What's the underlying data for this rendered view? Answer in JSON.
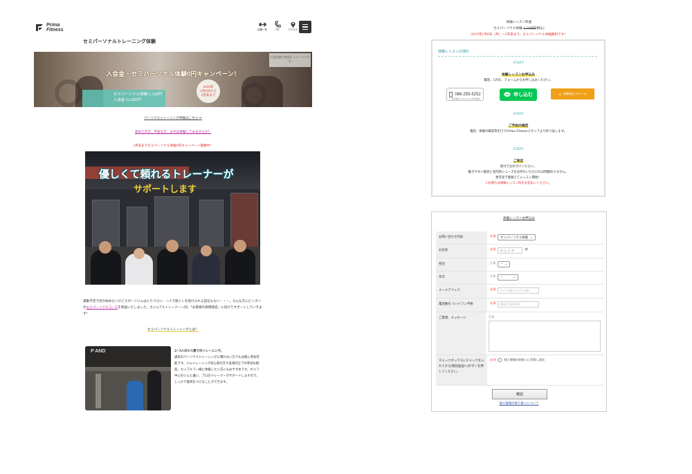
{
  "header": {
    "logo_line1": "Prima",
    "logo_line2": "Fitness",
    "icons": [
      {
        "name": "dumbbell-icon",
        "label": "店舗一覧"
      },
      {
        "name": "phone-icon",
        "label": "TEL"
      },
      {
        "name": "map-pin-icon",
        "label": "アクセス"
      }
    ],
    "menu_icon": "hamburger-menu-icon"
  },
  "page_title": "セミパーソナルトレーニング体験",
  "banner": {
    "headline": "入会金・セミパーソナル体験0円キャンペーン！",
    "price_line1": "セミパーソナル体験 1,100円",
    "price_line2": "入会金 11,000円",
    "circle_year": "2025年",
    "circle_from": "1月6日から",
    "circle_to": "2月末まで",
    "corner_text": "大型店舗で快適な トレーニングを"
  },
  "links": {
    "personal_experience": "パーソナルトレーニング体験はこちら",
    "beginner": "初めての方、不安な方、まずは体験してみませんか？",
    "campaign_red": "2月末までセミパーソナル体験0円キャンペーン開催中！"
  },
  "photo1": {
    "heading": "優しくて頼れるトレーナーが",
    "sub": "サポートします"
  },
  "intro_paragraph": {
    "before": "運動不足で何か始めたいけどスポーツジムは入りづらい、一人で筋トレを続けられる自信もない・・・。そんな方にピッタリの",
    "link": "セミパーソナルコース",
    "after": "を新設いたしました。カジュアルトレーナー一同、「お客様の目標達成」に向けてサポートしていきます！"
  },
  "what_is_link": "セミパーソナルトレーニングとは？",
  "side": {
    "bold": "2~3人の少人数でのトレーニング。",
    "body": "通常のパーソナルトレーニングに慣れない方でも気軽に参加可能です。ジムトレーニング初心者の方や友達同士での参加も歓迎。カップルで一緒に体験したい方にもおすすめです。セルフ中心のジムと違い、プロのトレーナーがサポートしますので、しっかり筋肉をつけることができます。"
  },
  "right_top": {
    "line1": "体験レッスン料金",
    "line2_prefix": "セミパーソナル体験",
    "line2_strike": "1,100円",
    "line2_suffix": "(税込)",
    "line3": "2025年1月6日（月）～2月末まで、セミパーソナル体験無料です！"
  },
  "flow": {
    "heading": "体験レッスンの流れ",
    "step1_label": "STEP1",
    "step1_name": "体験レッスンお申込み",
    "step1_desc": "電話、LINE、フォームからお申し込みください。",
    "tel_number": "086-255-5252",
    "tel_note": "受付時間 10:00～21:00 年中無休",
    "line_btn": "申し込む",
    "form_btn": "体験申込フォーム",
    "step2_label": "STEP2",
    "step2_name": "ご予約の確定",
    "step2_desc": "電話、体験の確認等を行うPrima Fitnessスタッフより折り返します。",
    "step3_label": "STEP3",
    "step3_name": "ご来店",
    "step3_desc1": "受付でお声がけください。",
    "step3_desc2": "動きやすい服装と室内用シューズをお持ちいただければ問題ありません。",
    "step3_desc3": "更衣室で着替えてレッスン開始！",
    "step3_red": "※お帰りは体験レッスン料をお支払いください。"
  },
  "form": {
    "title": "体験レッスンお申込み",
    "required": "必須",
    "optional": "任意",
    "rows": [
      {
        "label": "お問い合わせ内容",
        "value": "セミパーソナル体験"
      },
      {
        "label": "お名前",
        "placeholder": "岡 山 太 郎",
        "suffix": "様"
      },
      {
        "label": "性別",
        "value": "--"
      },
      {
        "label": "年代",
        "value": "--"
      },
      {
        "label": "メールアドレス",
        "placeholder": "××××@××××.com"
      },
      {
        "label": "電話番号 ※ハイフン不要",
        "placeholder": "08012345678"
      },
      {
        "label": "ご質問、メッセージ"
      },
      {
        "label": "チェックボックスにチェックを入れてから[確認画面へ]ボタンを押してください。",
        "value": "個人情報の取扱いに同意し送信"
      }
    ],
    "confirm": "確認",
    "privacy": "個人情報の取り扱いについて"
  },
  "colors": {
    "teal": "#2aa39a",
    "red": "#e02c2c",
    "pink": "#b4209a",
    "line_green": "#06c755",
    "orange": "#f0a018"
  }
}
